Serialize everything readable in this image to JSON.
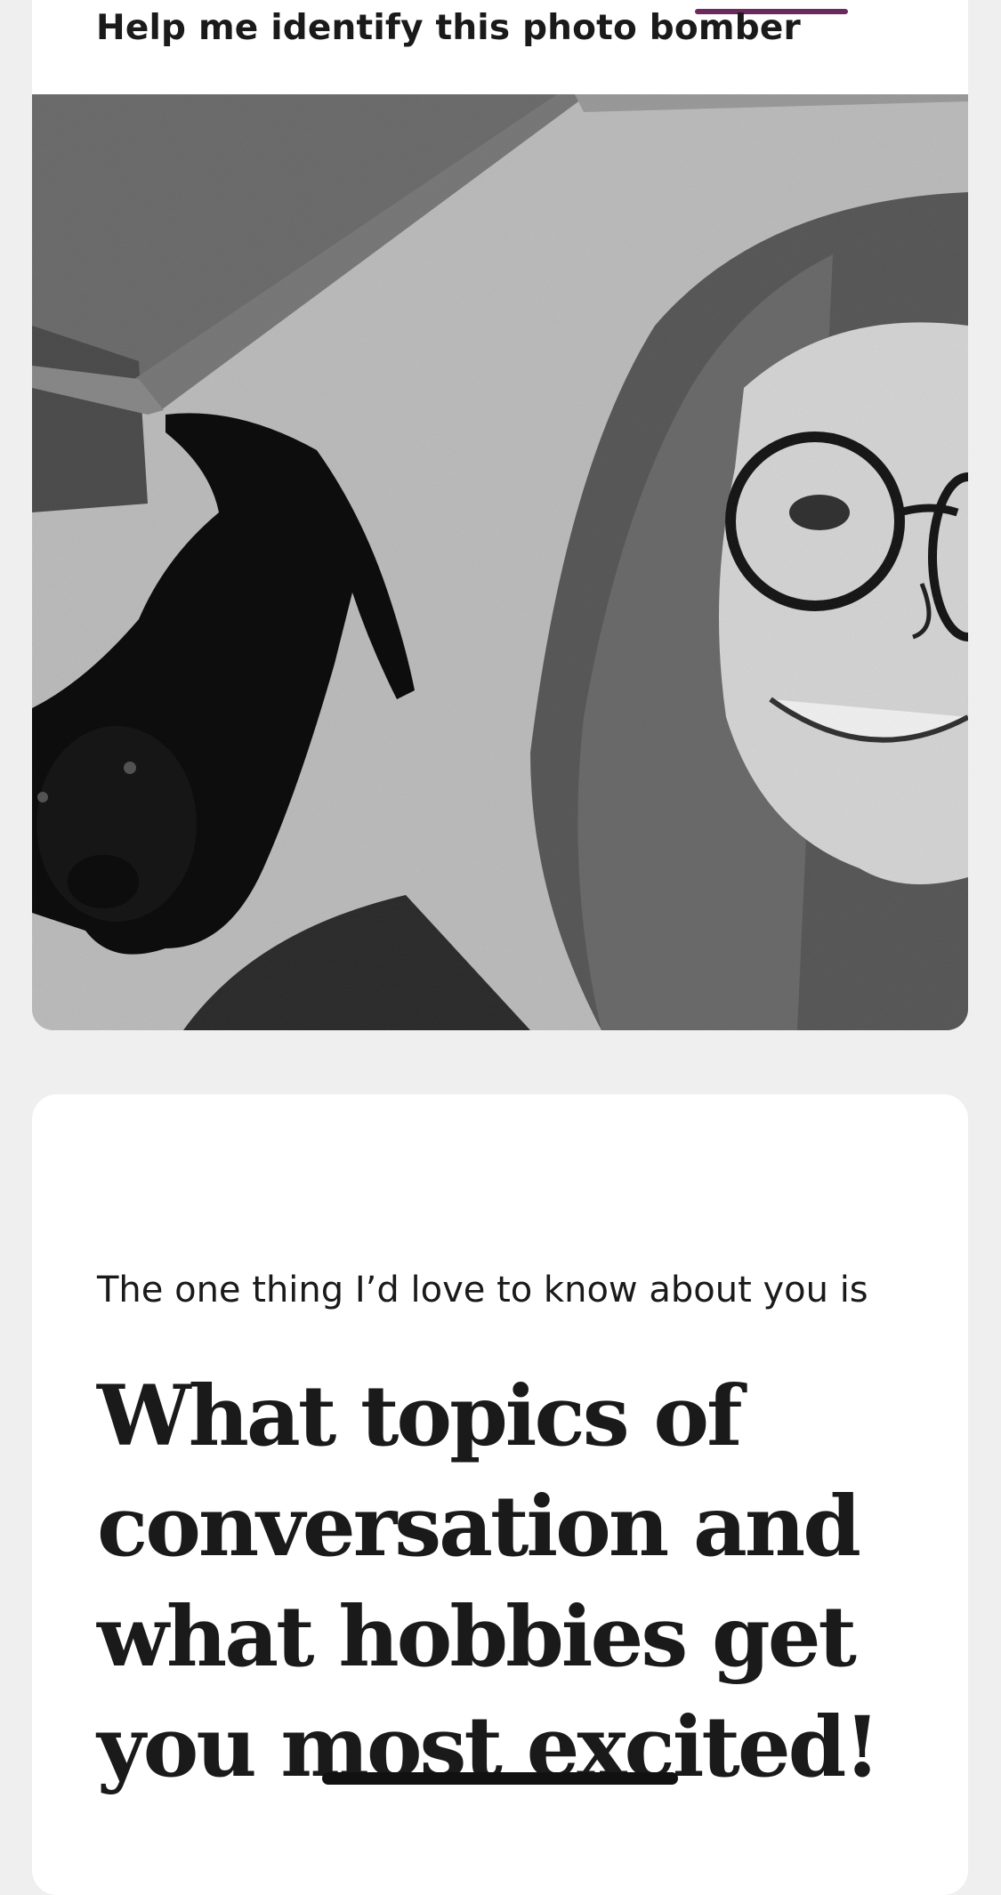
{
  "prompt_top": {
    "text": "Help me identify this photo bomber"
  },
  "photo": {
    "description_icon": "photo-image",
    "colors": {
      "accent": "#6b2a5e"
    }
  },
  "prompt_card": {
    "label": "The one thing I’d love to know about you is",
    "answer": "What topics of conversation and what hobbies get you most excited!"
  }
}
